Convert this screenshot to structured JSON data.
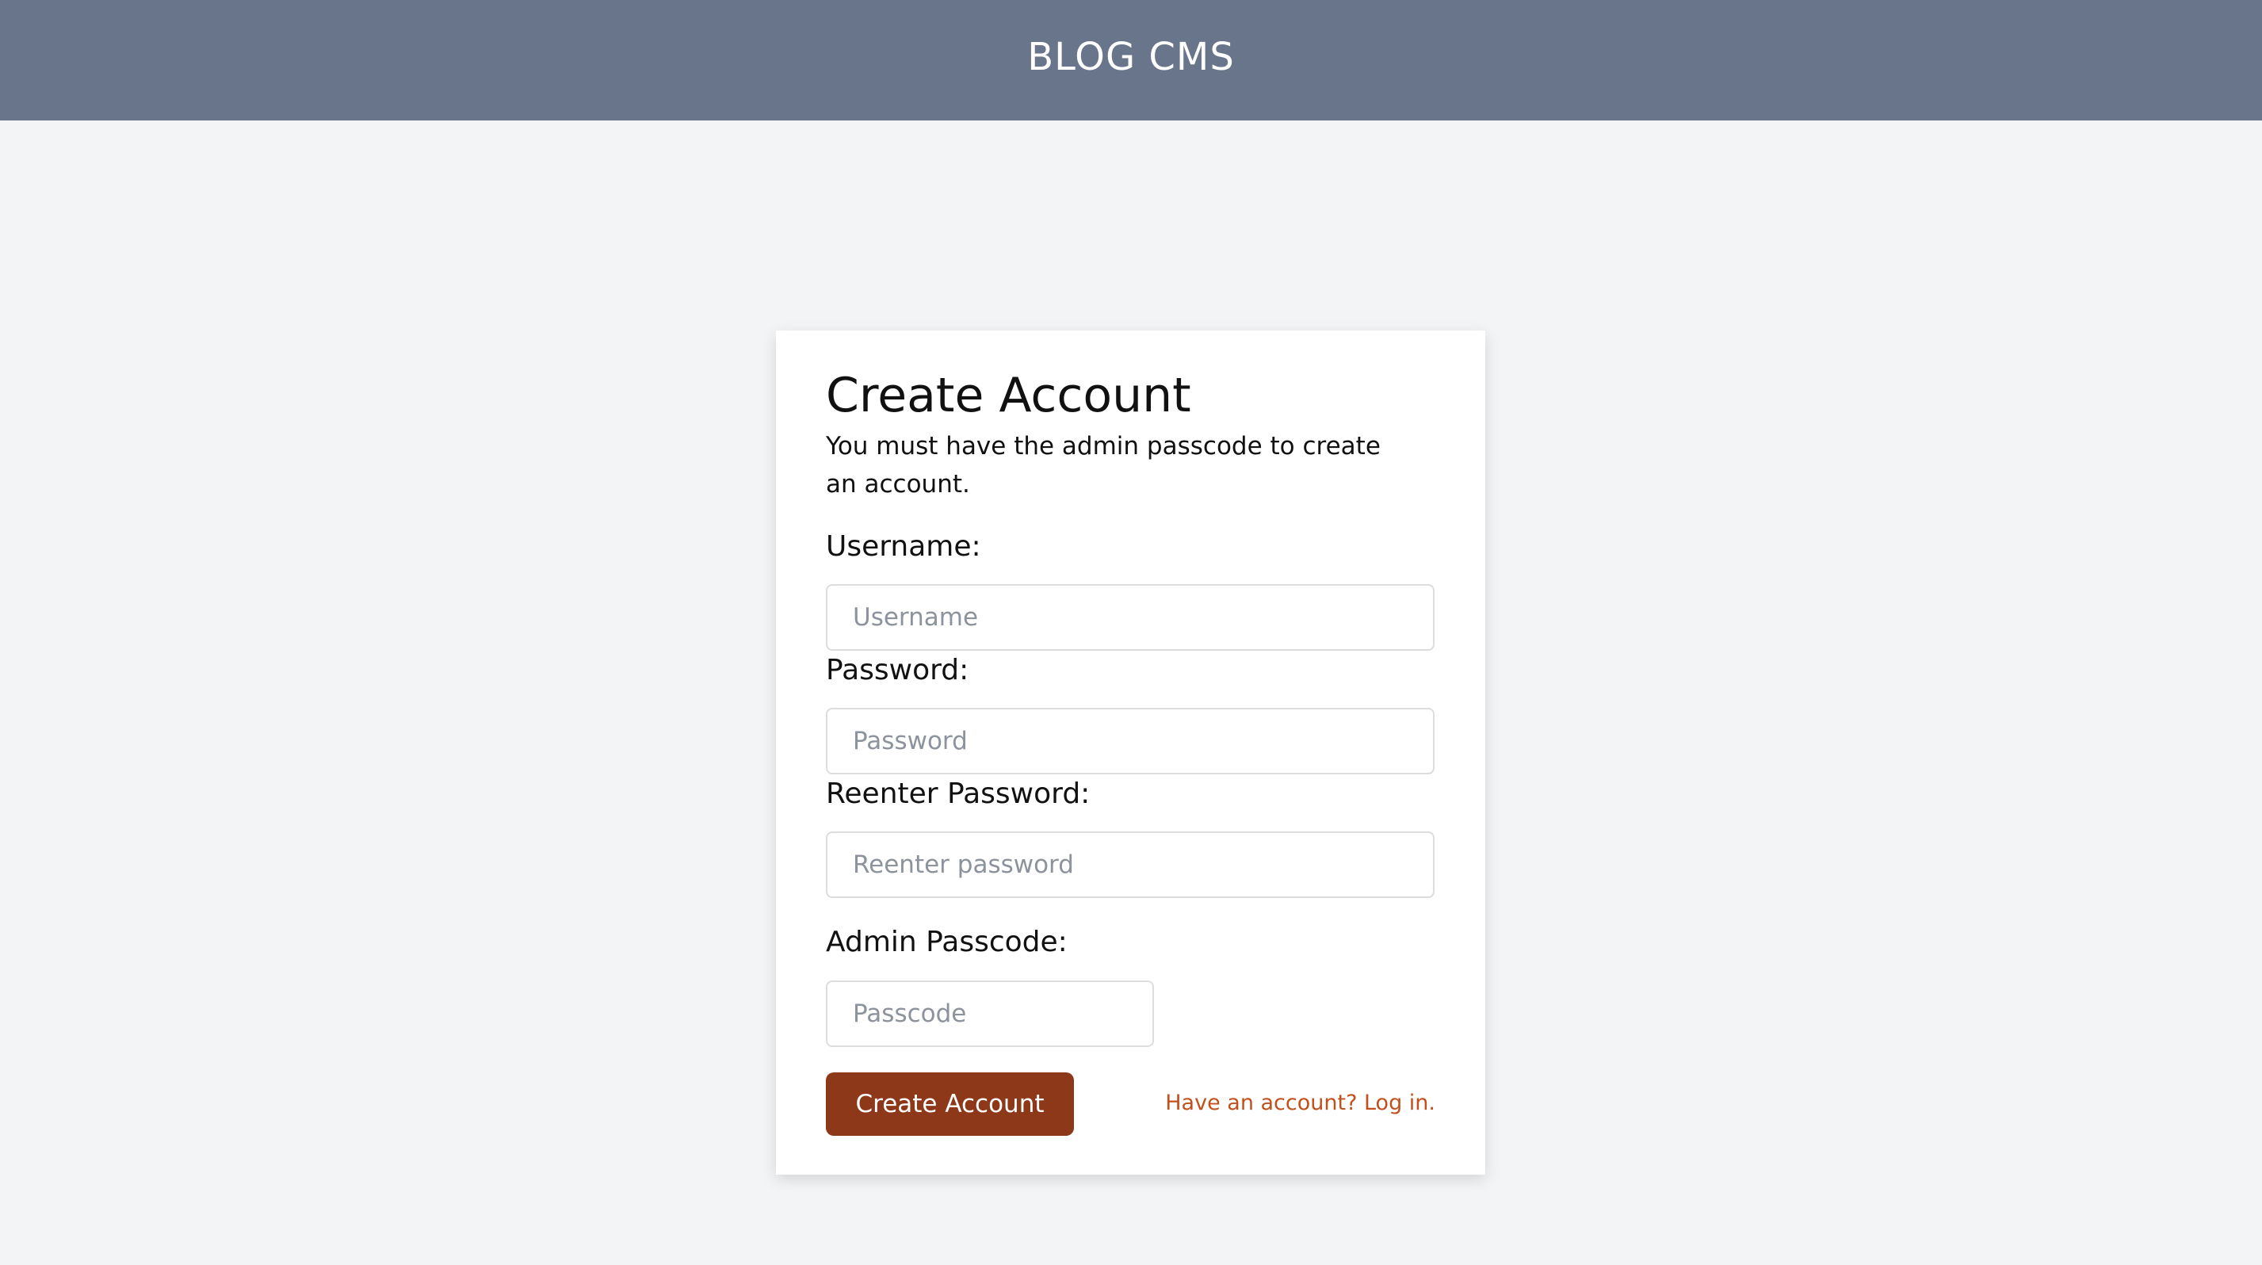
{
  "header": {
    "title": "BLOG CMS"
  },
  "form": {
    "title": "Create Account",
    "subtitle": "You must have the admin passcode to create an account.",
    "username": {
      "label": "Username:",
      "placeholder": "Username",
      "value": ""
    },
    "password": {
      "label": "Password:",
      "placeholder": "Password",
      "value": ""
    },
    "reenter_password": {
      "label": "Reenter Password:",
      "placeholder": "Reenter password",
      "value": ""
    },
    "admin_passcode": {
      "label": "Admin Passcode:",
      "placeholder": "Passcode",
      "value": ""
    },
    "submit_label": "Create Account",
    "login_link": "Have an account? Log in."
  },
  "colors": {
    "header_bg": "#68758b",
    "page_bg": "#f3f4f6",
    "button_bg": "#8c3819",
    "link": "#c2501d"
  }
}
